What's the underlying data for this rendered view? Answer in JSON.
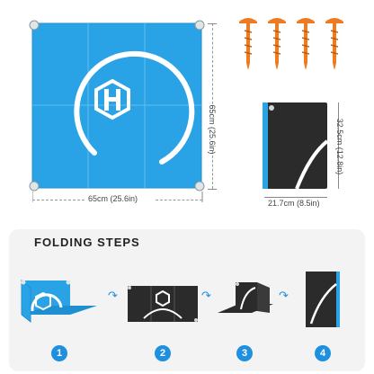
{
  "mat": {
    "width_label": "65cm  (25.6in)",
    "height_label": "65cm  (25.6in)",
    "color": "#2aa3e6"
  },
  "stakes": {
    "count": 4,
    "color": "#f07a1f"
  },
  "folded": {
    "width_label": "21.7cm  (8.5in)",
    "height_label": "32.5cm  (12.8in)",
    "color": "#2b2b2b"
  },
  "folding": {
    "title": "FOLDING STEPS",
    "steps": [
      {
        "number": "1"
      },
      {
        "number": "2"
      },
      {
        "number": "3"
      },
      {
        "number": "4"
      }
    ],
    "arrow_icon": "curved-arrow-icon"
  }
}
